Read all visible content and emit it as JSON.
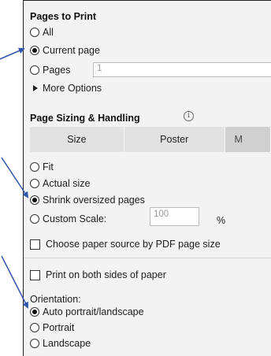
{
  "pages_to_print": {
    "heading": "Pages to Print",
    "options": {
      "all": "All",
      "current_page": "Current page",
      "pages": "Pages"
    },
    "pages_value": "1",
    "more_options": "More Options"
  },
  "page_sizing": {
    "heading": "Page Sizing & Handling",
    "info_glyph": "i",
    "tabs": {
      "size": "Size",
      "poster": "Poster",
      "multiple": "M"
    },
    "options": {
      "fit": "Fit",
      "actual_size": "Actual size",
      "shrink": "Shrink oversized pages",
      "custom_scale": "Custom Scale:"
    },
    "custom_scale_value": "100",
    "percent": "%",
    "choose_paper_source": "Choose paper source by PDF page size",
    "print_both_sides": "Print on both sides of paper",
    "orientation_label": "Orientation:",
    "orientation": {
      "auto": "Auto portrait/landscape",
      "portrait": "Portrait",
      "landscape": "Landscape"
    }
  },
  "selected": {
    "pages_to_print": "current_page",
    "page_sizing": "shrink",
    "orientation": "auto"
  },
  "colors": {
    "arrow": "#2e55a8",
    "panel_bg": "#f3f3f3",
    "tab_bg": "#e2e2e2"
  }
}
